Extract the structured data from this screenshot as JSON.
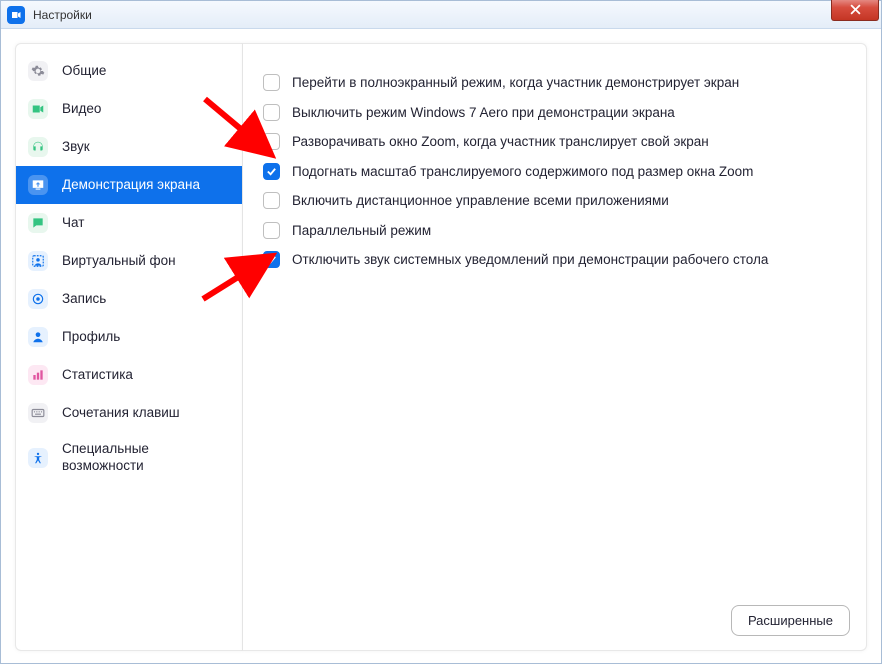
{
  "window": {
    "title": "Настройки"
  },
  "sidebar": {
    "items": [
      {
        "label": "Общие",
        "icon": "gear"
      },
      {
        "label": "Видео",
        "icon": "video"
      },
      {
        "label": "Звук",
        "icon": "headset"
      },
      {
        "label": "Демонстрация экрана",
        "icon": "share"
      },
      {
        "label": "Чат",
        "icon": "chat"
      },
      {
        "label": "Виртуальный фон",
        "icon": "vbg"
      },
      {
        "label": "Запись",
        "icon": "record"
      },
      {
        "label": "Профиль",
        "icon": "profile"
      },
      {
        "label": "Статистика",
        "icon": "stats"
      },
      {
        "label": "Сочетания клавиш",
        "icon": "keyboard"
      },
      {
        "label": "Специальные возможности",
        "icon": "a11y"
      }
    ],
    "active_index": 3
  },
  "options": [
    {
      "label": "Перейти в полноэкранный режим, когда участник демонстрирует экран",
      "checked": false
    },
    {
      "label": "Выключить режим Windows 7 Aero при демонстрации экрана",
      "checked": false
    },
    {
      "label": "Разворачивать окно Zoom, когда участник транслирует свой экран",
      "checked": false
    },
    {
      "label": "Подогнать масштаб транслируемого содержимого под размер окна Zoom",
      "checked": true
    },
    {
      "label": "Включить дистанционное управление всеми приложениями",
      "checked": false
    },
    {
      "label": "Параллельный режим",
      "checked": false
    },
    {
      "label": "Отключить звук системных уведомлений при демонстрации рабочего стола",
      "checked": true
    }
  ],
  "footer": {
    "advanced_label": "Расширенные"
  },
  "colors": {
    "accent": "#0e71eb",
    "arrow": "#ff0000"
  }
}
